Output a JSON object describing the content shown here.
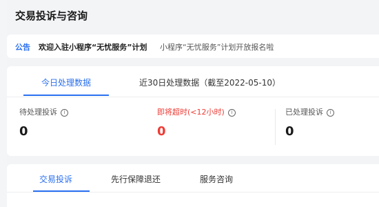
{
  "page": {
    "title": "交易投诉与咨询"
  },
  "notice": {
    "tag": "公告",
    "title": "欢迎入驻小程序“无忧服务”计划",
    "description": "小程序“无忧服务”计划开放报名啦"
  },
  "stats": {
    "tabs": [
      {
        "label": "今日处理数据",
        "active": true
      },
      {
        "label": "近30日处理数据（截至2022-05-10）",
        "active": false
      }
    ],
    "metrics": [
      {
        "label": "待处理投诉",
        "value": "0"
      },
      {
        "label": "即将超时(<12小时)",
        "value": "0"
      },
      {
        "label": "已处理投诉",
        "value": "0"
      }
    ],
    "colors": {
      "accent": "#2a6ff0",
      "warning": "#ee3b34"
    },
    "icons": {
      "info": "info-icon"
    }
  },
  "bottom_tabs": [
    {
      "label": "交易投诉",
      "active": true
    },
    {
      "label": "先行保障退还",
      "active": false
    },
    {
      "label": "服务咨询",
      "active": false
    }
  ]
}
